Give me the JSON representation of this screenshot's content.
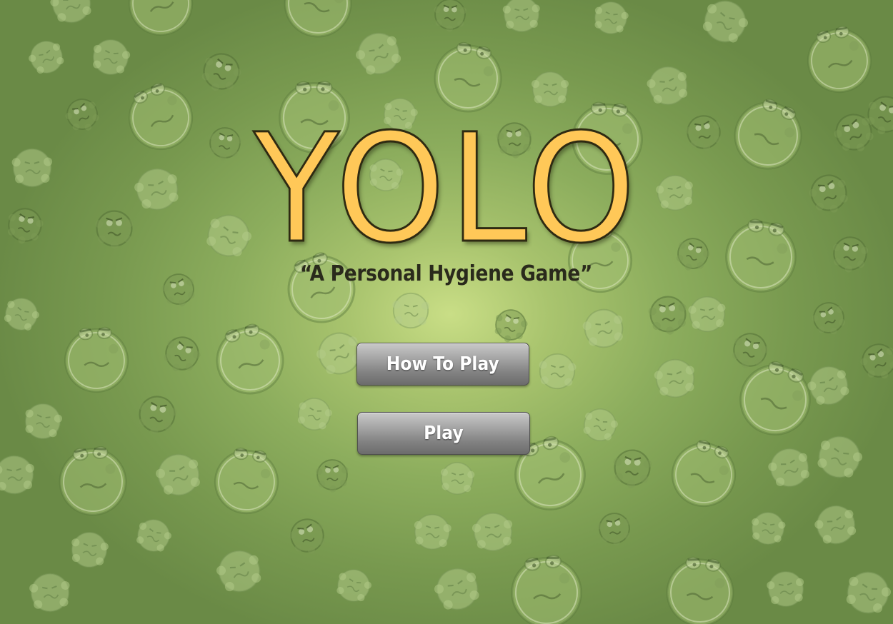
{
  "title": "YOLO",
  "subtitle": "“A Personal Hygiene Game”",
  "menu": {
    "how_to_play_label": "How To Play",
    "play_label": "Play"
  },
  "background": {
    "decoration": "germ-pattern",
    "colors": {
      "center": "#c9de86",
      "edge": "#6a8a46",
      "germ_fill": "#a8c47a",
      "germ_outline": "#5b7a3c"
    }
  },
  "colors": {
    "title_fill": "#ffc858",
    "title_outline": "#2e2a12",
    "subtitle": "#2a2a1c",
    "button_top": "#c9c9c9",
    "button_bottom": "#6c6c6c",
    "button_text": "#ffffff"
  }
}
